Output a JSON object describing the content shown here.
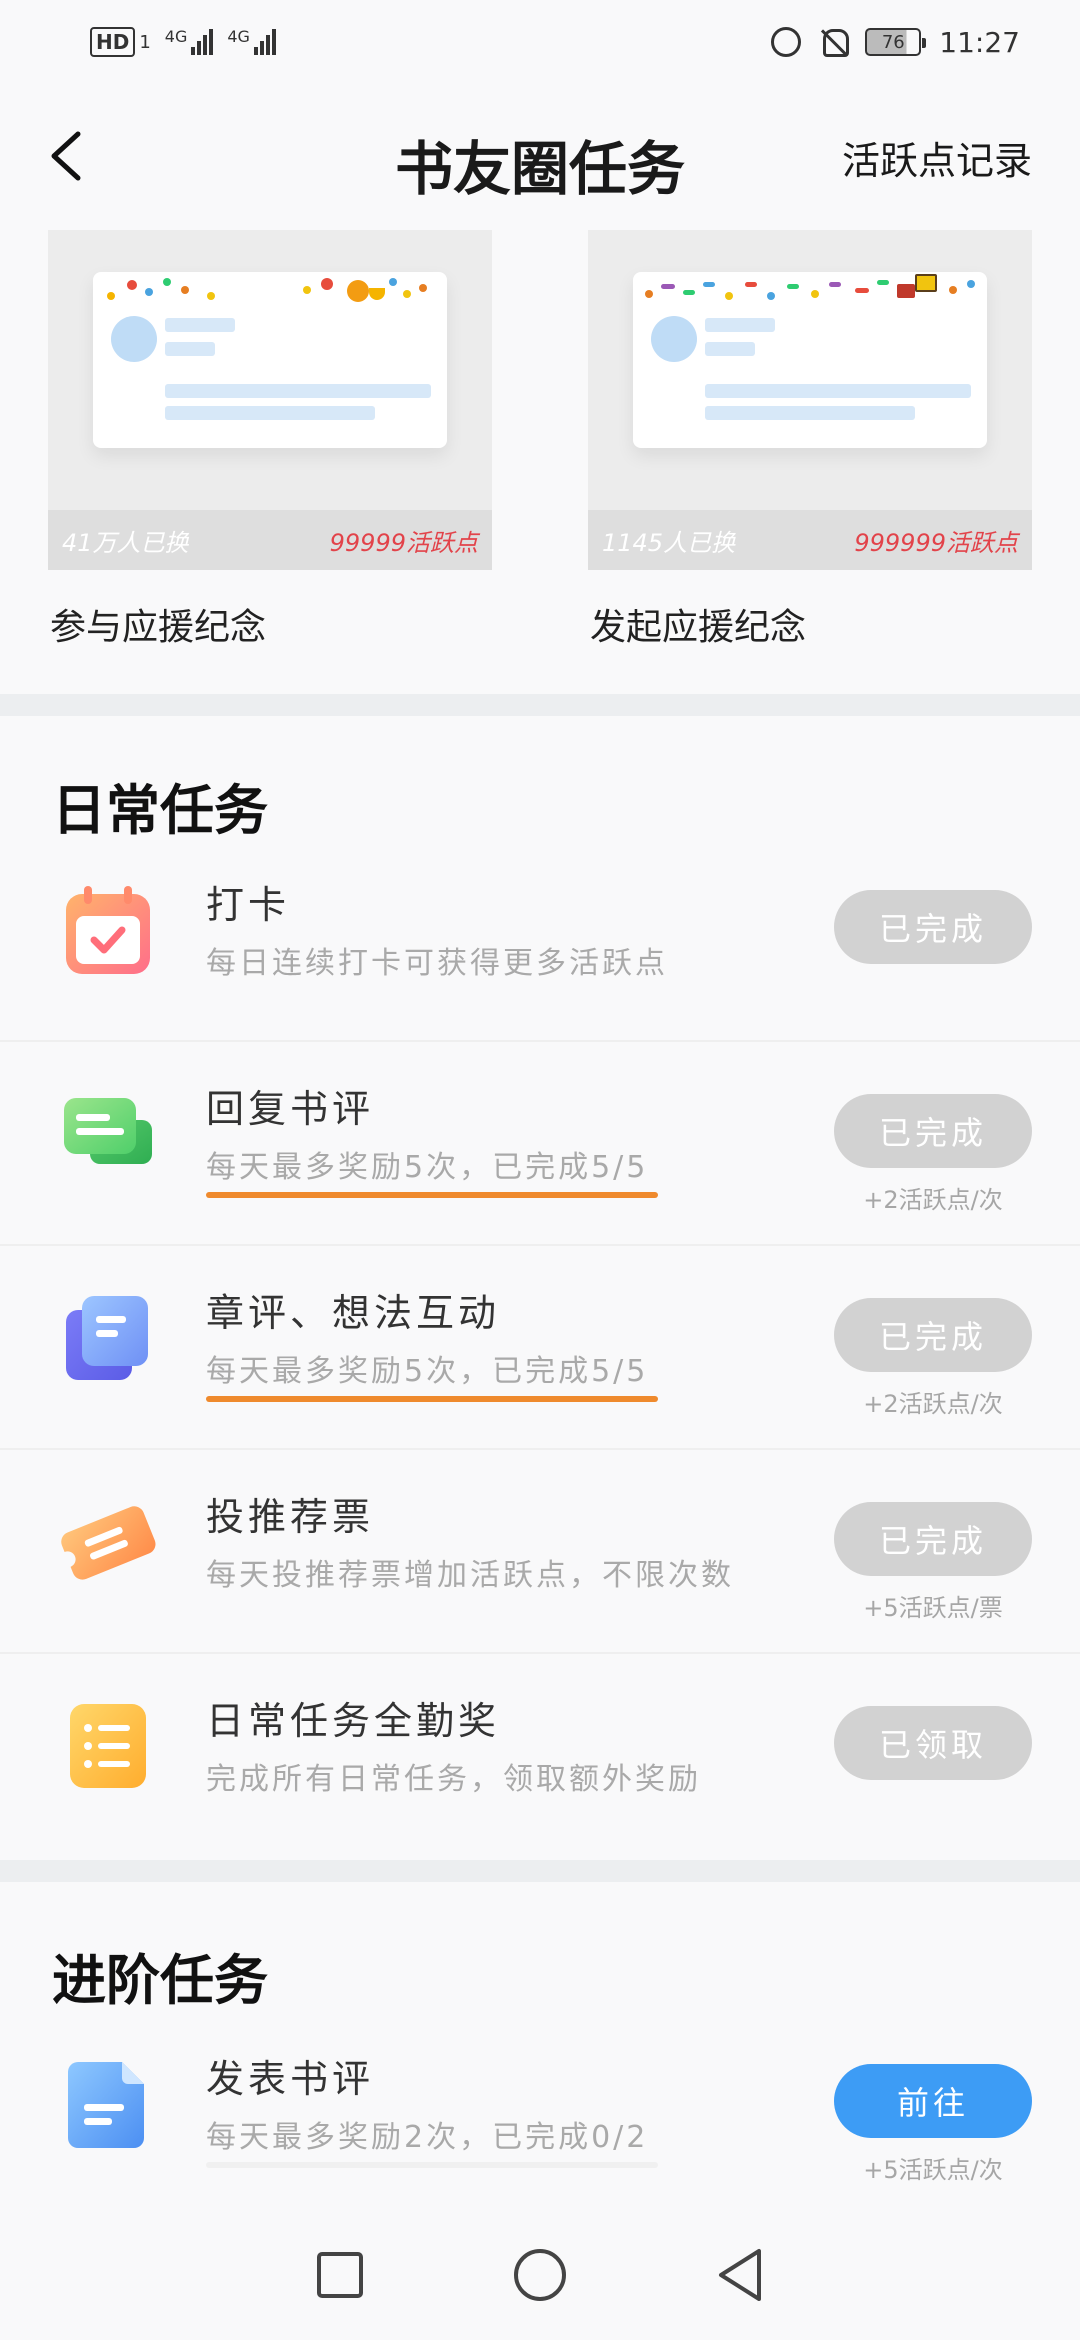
{
  "status_bar": {
    "hd": "HD",
    "sim1": "1",
    "net1": "4G",
    "net2": "4G",
    "battery": "76",
    "time": "11:27"
  },
  "header": {
    "title": "书友圈任务",
    "right_link": "活跃点记录"
  },
  "badges": [
    {
      "count": "41万人已换",
      "points": "99999活跃点",
      "name": "参与应援纪念"
    },
    {
      "count": "1145人已换",
      "points": "999999活跃点",
      "name": "发起应援纪念"
    }
  ],
  "daily": {
    "title": "日常任务",
    "tasks": [
      {
        "icon": "calendar-check-icon",
        "name": "打卡",
        "desc": "每日连续打卡可获得更多活跃点",
        "button": "已完成",
        "reward": ""
      },
      {
        "icon": "chat-bubbles-icon",
        "name": "回复书评",
        "desc": "每天最多奖励5次，已完成5/5",
        "button": "已完成",
        "reward": "+2活跃点/次"
      },
      {
        "icon": "stacked-doc-icon",
        "name": "章评、想法互动",
        "desc": "每天最多奖励5次，已完成5/5",
        "button": "已完成",
        "reward": "+2活跃点/次"
      },
      {
        "icon": "ticket-icon",
        "name": "投推荐票",
        "desc": "每天投推荐票增加活跃点，不限次数",
        "button": "已完成",
        "reward": "+5活跃点/票"
      },
      {
        "icon": "list-icon",
        "name": "日常任务全勤奖",
        "desc": "完成所有日常任务，领取额外奖励",
        "button": "已领取",
        "reward": ""
      }
    ]
  },
  "advanced": {
    "title": "进阶任务",
    "tasks": [
      {
        "icon": "document-icon",
        "name": "发表书评",
        "desc": "每天最多奖励2次，已完成0/2",
        "button": "前往",
        "reward": "+5活跃点/次"
      }
    ]
  },
  "colors": {
    "accent_blue": "#3d9cf5",
    "done_gray": "#d2d2d2",
    "highlight_orange": "#ef8a2d",
    "points_red": "#e2434a"
  }
}
